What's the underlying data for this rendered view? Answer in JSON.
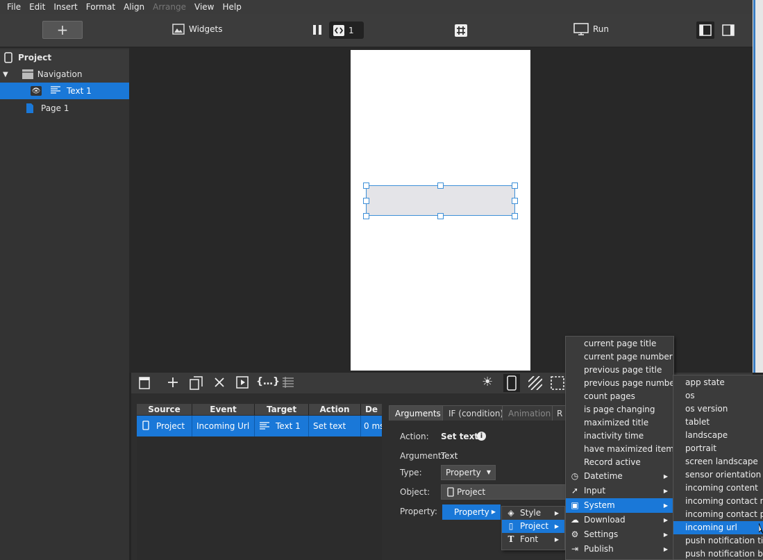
{
  "menubar": {
    "items": [
      "File",
      "Edit",
      "Insert",
      "Format",
      "Align",
      "Arrange",
      "View",
      "Help"
    ]
  },
  "toolbar": {
    "add": "+",
    "widgets": "Widgets",
    "page_count": "1",
    "run": "Run"
  },
  "tree": {
    "project": "Project",
    "navigation": "Navigation",
    "text1": "Text 1",
    "page1": "Page 1"
  },
  "table": {
    "headers": [
      "Source",
      "Event",
      "Target",
      "Action",
      "De"
    ],
    "row": {
      "source": "Project",
      "event": "Incoming Url",
      "target": "Text 1",
      "action": "Set text",
      "delay": "0 ms"
    }
  },
  "props": {
    "tabs": [
      "Arguments",
      "IF (condition)",
      "Animation",
      "R"
    ],
    "action_label": "Action:",
    "action_value": "Set text",
    "argument_label": "Argument:",
    "argument_value": "Text",
    "type_label": "Type:",
    "type_value": "Property",
    "object_label": "Object:",
    "object_value": "Project",
    "property_label": "Property:",
    "property_value": "Property"
  },
  "submenu1": {
    "style": "Style",
    "project": "Project",
    "font": "Font"
  },
  "menu_main": {
    "items": [
      "current page title",
      "current page number",
      "previous page title",
      "previous page number",
      "count pages",
      "is page changing",
      "maximized title",
      "inactivity time",
      "have maximized item",
      "Record active"
    ],
    "sub_items": [
      "Datetime",
      "Input",
      "System",
      "Download",
      "Settings",
      "Publish"
    ]
  },
  "menu_system": {
    "items": [
      "app state",
      "os",
      "os version",
      "tablet",
      "landscape",
      "portrait",
      "screen landscape",
      "sensor orientation",
      "incoming content",
      "incoming contact nam",
      "incoming contact pho",
      "incoming url",
      "push notification title",
      "push notification bod"
    ]
  },
  "colors": {
    "accent": "#1a78d8",
    "bg": "#252525",
    "panel": "#333333"
  }
}
